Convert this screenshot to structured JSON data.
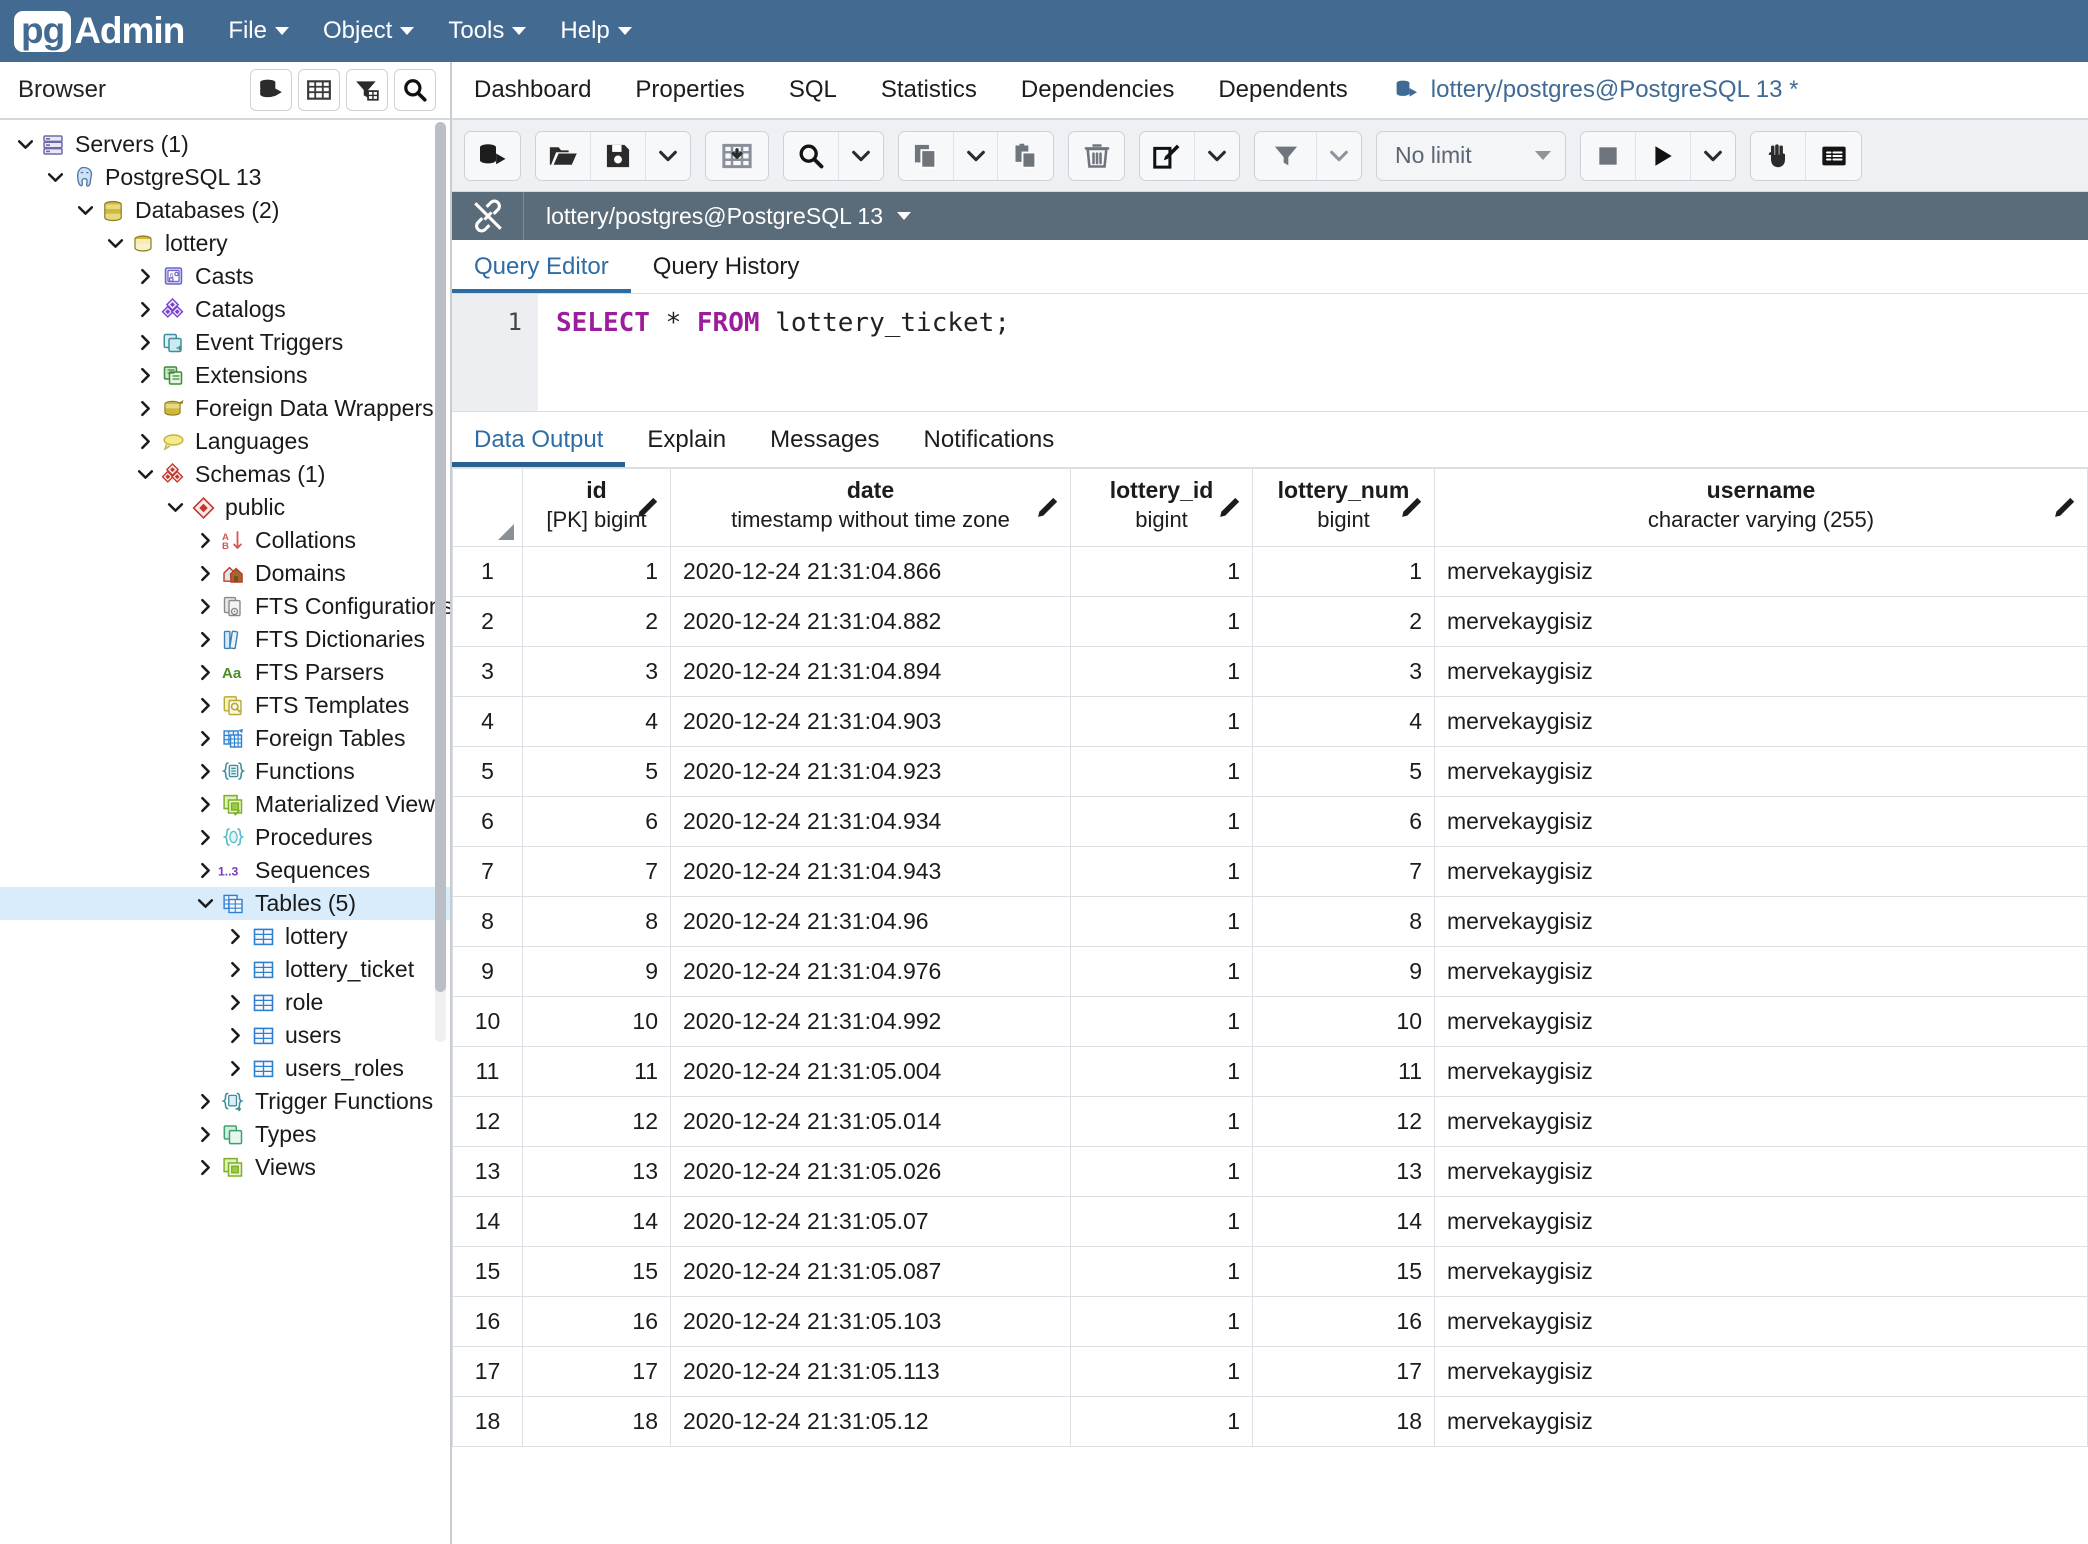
{
  "app": {
    "logo_pg": "pg",
    "logo_admin": "Admin",
    "menus": [
      "File",
      "Object",
      "Tools",
      "Help"
    ]
  },
  "browser": {
    "title": "Browser",
    "header_buttons": [
      "server-connect-icon",
      "grid-icon",
      "filter-table-icon",
      "search-icon"
    ],
    "tree": [
      {
        "label": "Servers (1)",
        "depth": 0,
        "state": "expanded",
        "icon": "servers-icon",
        "selected": false
      },
      {
        "label": "PostgreSQL 13",
        "depth": 1,
        "state": "expanded",
        "icon": "postgres-elephant-icon",
        "selected": false
      },
      {
        "label": "Databases (2)",
        "depth": 2,
        "state": "expanded",
        "icon": "databases-icon",
        "selected": false
      },
      {
        "label": "lottery",
        "depth": 3,
        "state": "expanded",
        "icon": "database-icon",
        "selected": false
      },
      {
        "label": "Casts",
        "depth": 4,
        "state": "collapsed",
        "icon": "casts-icon",
        "selected": false
      },
      {
        "label": "Catalogs",
        "depth": 4,
        "state": "collapsed",
        "icon": "catalogs-icon",
        "selected": false
      },
      {
        "label": "Event Triggers",
        "depth": 4,
        "state": "collapsed",
        "icon": "event-triggers-icon",
        "selected": false
      },
      {
        "label": "Extensions",
        "depth": 4,
        "state": "collapsed",
        "icon": "extensions-icon",
        "selected": false
      },
      {
        "label": "Foreign Data Wrappers",
        "depth": 4,
        "state": "collapsed",
        "icon": "fdw-icon",
        "selected": false
      },
      {
        "label": "Languages",
        "depth": 4,
        "state": "collapsed",
        "icon": "languages-icon",
        "selected": false
      },
      {
        "label": "Schemas (1)",
        "depth": 4,
        "state": "expanded",
        "icon": "schemas-icon",
        "selected": false
      },
      {
        "label": "public",
        "depth": 5,
        "state": "expanded",
        "icon": "schema-icon",
        "selected": false
      },
      {
        "label": "Collations",
        "depth": 6,
        "state": "collapsed",
        "icon": "collations-icon",
        "selected": false
      },
      {
        "label": "Domains",
        "depth": 6,
        "state": "collapsed",
        "icon": "domains-icon",
        "selected": false
      },
      {
        "label": "FTS Configurations",
        "depth": 6,
        "state": "collapsed",
        "icon": "fts-config-icon",
        "selected": false
      },
      {
        "label": "FTS Dictionaries",
        "depth": 6,
        "state": "collapsed",
        "icon": "fts-dict-icon",
        "selected": false
      },
      {
        "label": "FTS Parsers",
        "depth": 6,
        "state": "collapsed",
        "icon": "fts-parser-icon",
        "selected": false
      },
      {
        "label": "FTS Templates",
        "depth": 6,
        "state": "collapsed",
        "icon": "fts-template-icon",
        "selected": false
      },
      {
        "label": "Foreign Tables",
        "depth": 6,
        "state": "collapsed",
        "icon": "foreign-tables-icon",
        "selected": false
      },
      {
        "label": "Functions",
        "depth": 6,
        "state": "collapsed",
        "icon": "functions-icon",
        "selected": false
      },
      {
        "label": "Materialized Views",
        "depth": 6,
        "state": "collapsed",
        "icon": "matviews-icon",
        "selected": false
      },
      {
        "label": "Procedures",
        "depth": 6,
        "state": "collapsed",
        "icon": "procedures-icon",
        "selected": false
      },
      {
        "label": "Sequences",
        "depth": 6,
        "state": "collapsed",
        "icon": "sequences-icon",
        "selected": false
      },
      {
        "label": "Tables (5)",
        "depth": 6,
        "state": "expanded",
        "icon": "tables-icon",
        "selected": true
      },
      {
        "label": "lottery",
        "depth": 7,
        "state": "collapsed",
        "icon": "table-icon",
        "selected": false
      },
      {
        "label": "lottery_ticket",
        "depth": 7,
        "state": "collapsed",
        "icon": "table-icon",
        "selected": false
      },
      {
        "label": "role",
        "depth": 7,
        "state": "collapsed",
        "icon": "table-icon",
        "selected": false
      },
      {
        "label": "users",
        "depth": 7,
        "state": "collapsed",
        "icon": "table-icon",
        "selected": false
      },
      {
        "label": "users_roles",
        "depth": 7,
        "state": "collapsed",
        "icon": "table-icon",
        "selected": false
      },
      {
        "label": "Trigger Functions",
        "depth": 6,
        "state": "collapsed",
        "icon": "trigger-functions-icon",
        "selected": false
      },
      {
        "label": "Types",
        "depth": 6,
        "state": "collapsed",
        "icon": "types-icon",
        "selected": false
      },
      {
        "label": "Views",
        "depth": 6,
        "state": "collapsed",
        "icon": "views-icon",
        "selected": false
      }
    ]
  },
  "object_tabs": [
    {
      "label": "Dashboard",
      "active": false,
      "icon": null
    },
    {
      "label": "Properties",
      "active": false,
      "icon": null
    },
    {
      "label": "SQL",
      "active": false,
      "icon": null
    },
    {
      "label": "Statistics",
      "active": false,
      "icon": null
    },
    {
      "label": "Dependencies",
      "active": false,
      "icon": null
    },
    {
      "label": "Dependents",
      "active": false,
      "icon": null
    },
    {
      "label": "lottery/postgres@PostgreSQL 13 *",
      "active": true,
      "icon": "query-tool-icon"
    }
  ],
  "query_toolbar": {
    "groups": [
      {
        "buttons": [
          {
            "icon": "open-query-tool-icon"
          }
        ]
      },
      {
        "buttons": [
          {
            "icon": "open-file-icon"
          },
          {
            "icon": "save-icon"
          },
          {
            "icon": "chevron-down-icon"
          }
        ]
      },
      {
        "buttons": [
          {
            "icon": "copy-to-grid-icon"
          }
        ]
      },
      {
        "buttons": [
          {
            "icon": "search-icon"
          },
          {
            "icon": "chevron-down-icon"
          }
        ]
      },
      {
        "buttons": [
          {
            "icon": "copy-icon"
          },
          {
            "icon": "chevron-down-icon"
          },
          {
            "icon": "paste-icon"
          }
        ]
      },
      {
        "buttons": [
          {
            "icon": "trash-icon"
          }
        ]
      },
      {
        "buttons": [
          {
            "icon": "edit-icon"
          },
          {
            "icon": "chevron-down-icon"
          }
        ]
      },
      {
        "buttons": [
          {
            "icon": "filter-icon"
          },
          {
            "icon": "chevron-down-icon"
          }
        ]
      },
      {
        "buttons": [
          {
            "icon": "stop-icon"
          },
          {
            "icon": "execute-play-icon"
          },
          {
            "icon": "chevron-down-icon"
          }
        ]
      },
      {
        "buttons": [
          {
            "icon": "macro-hand-icon"
          },
          {
            "icon": "list-panel-icon"
          }
        ]
      }
    ],
    "row_limit_value": "No limit"
  },
  "connection_bar": {
    "icon": "disconnected-plug-icon",
    "label": "lottery/postgres@PostgreSQL 13"
  },
  "editor_tabs": [
    {
      "label": "Query Editor",
      "active": true
    },
    {
      "label": "Query History",
      "active": false
    }
  ],
  "sql": {
    "line_number": "1",
    "keyword1": "SELECT",
    "star": " * ",
    "keyword2": "FROM",
    "rest": " lottery_ticket;"
  },
  "output_tabs": [
    {
      "label": "Data Output",
      "active": true
    },
    {
      "label": "Explain",
      "active": false
    },
    {
      "label": "Messages",
      "active": false
    },
    {
      "label": "Notifications",
      "active": false
    }
  ],
  "result_grid": {
    "columns": [
      {
        "name": "id",
        "type": "[PK] bigint",
        "align": "right"
      },
      {
        "name": "date",
        "type": "timestamp without time zone",
        "align": "left"
      },
      {
        "name": "lottery_id",
        "type": "bigint",
        "align": "right"
      },
      {
        "name": "lottery_num",
        "type": "bigint",
        "align": "right"
      },
      {
        "name": "username",
        "type": "character varying (255)",
        "align": "left"
      }
    ],
    "rows": [
      {
        "n": "1",
        "id": "1",
        "date": "2020-12-24 21:31:04.866",
        "lottery_id": "1",
        "lottery_num": "1",
        "username": "mervekaygisiz"
      },
      {
        "n": "2",
        "id": "2",
        "date": "2020-12-24 21:31:04.882",
        "lottery_id": "1",
        "lottery_num": "2",
        "username": "mervekaygisiz"
      },
      {
        "n": "3",
        "id": "3",
        "date": "2020-12-24 21:31:04.894",
        "lottery_id": "1",
        "lottery_num": "3",
        "username": "mervekaygisiz"
      },
      {
        "n": "4",
        "id": "4",
        "date": "2020-12-24 21:31:04.903",
        "lottery_id": "1",
        "lottery_num": "4",
        "username": "mervekaygisiz"
      },
      {
        "n": "5",
        "id": "5",
        "date": "2020-12-24 21:31:04.923",
        "lottery_id": "1",
        "lottery_num": "5",
        "username": "mervekaygisiz"
      },
      {
        "n": "6",
        "id": "6",
        "date": "2020-12-24 21:31:04.934",
        "lottery_id": "1",
        "lottery_num": "6",
        "username": "mervekaygisiz"
      },
      {
        "n": "7",
        "id": "7",
        "date": "2020-12-24 21:31:04.943",
        "lottery_id": "1",
        "lottery_num": "7",
        "username": "mervekaygisiz"
      },
      {
        "n": "8",
        "id": "8",
        "date": "2020-12-24 21:31:04.96",
        "lottery_id": "1",
        "lottery_num": "8",
        "username": "mervekaygisiz"
      },
      {
        "n": "9",
        "id": "9",
        "date": "2020-12-24 21:31:04.976",
        "lottery_id": "1",
        "lottery_num": "9",
        "username": "mervekaygisiz"
      },
      {
        "n": "10",
        "id": "10",
        "date": "2020-12-24 21:31:04.992",
        "lottery_id": "1",
        "lottery_num": "10",
        "username": "mervekaygisiz"
      },
      {
        "n": "11",
        "id": "11",
        "date": "2020-12-24 21:31:05.004",
        "lottery_id": "1",
        "lottery_num": "11",
        "username": "mervekaygisiz"
      },
      {
        "n": "12",
        "id": "12",
        "date": "2020-12-24 21:31:05.014",
        "lottery_id": "1",
        "lottery_num": "12",
        "username": "mervekaygisiz"
      },
      {
        "n": "13",
        "id": "13",
        "date": "2020-12-24 21:31:05.026",
        "lottery_id": "1",
        "lottery_num": "13",
        "username": "mervekaygisiz"
      },
      {
        "n": "14",
        "id": "14",
        "date": "2020-12-24 21:31:05.07",
        "lottery_id": "1",
        "lottery_num": "14",
        "username": "mervekaygisiz"
      },
      {
        "n": "15",
        "id": "15",
        "date": "2020-12-24 21:31:05.087",
        "lottery_id": "1",
        "lottery_num": "15",
        "username": "mervekaygisiz"
      },
      {
        "n": "16",
        "id": "16",
        "date": "2020-12-24 21:31:05.103",
        "lottery_id": "1",
        "lottery_num": "16",
        "username": "mervekaygisiz"
      },
      {
        "n": "17",
        "id": "17",
        "date": "2020-12-24 21:31:05.113",
        "lottery_id": "1",
        "lottery_num": "17",
        "username": "mervekaygisiz"
      },
      {
        "n": "18",
        "id": "18",
        "date": "2020-12-24 21:31:05.12",
        "lottery_id": "1",
        "lottery_num": "18",
        "username": "mervekaygisiz"
      }
    ]
  },
  "colors": {
    "brand_blue": "#436b92",
    "conn_bar": "#5a6b79",
    "active_tab": "#2e6da4",
    "selection": "#d9ecfb",
    "sql_keyword": "#9b1d9b"
  }
}
